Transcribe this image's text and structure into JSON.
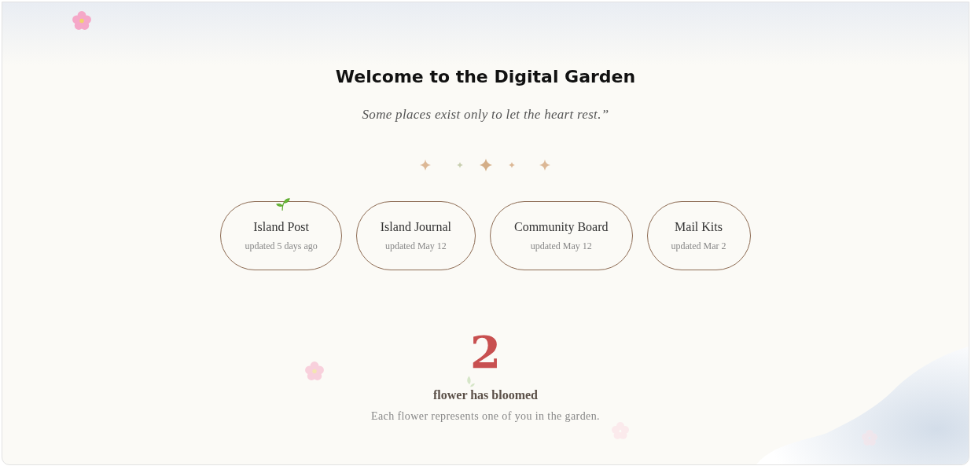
{
  "title": "Welcome to the Digital Garden",
  "quote": "Some places exist only to let the heart rest.”",
  "boards": [
    {
      "name": "Island Post",
      "updated": "updated 5 days ago",
      "sprout": true
    },
    {
      "name": "Island Journal",
      "updated": "updated May 12",
      "sprout": false
    },
    {
      "name": "Community Board",
      "updated": "updated May 12",
      "sprout": false
    },
    {
      "name": "Mail Kits",
      "updated": "updated Mar 2",
      "sprout": false
    }
  ],
  "bloom": {
    "count": "2",
    "label": "flower has bloomed",
    "caption": "Each flower represents one of you in the garden."
  }
}
